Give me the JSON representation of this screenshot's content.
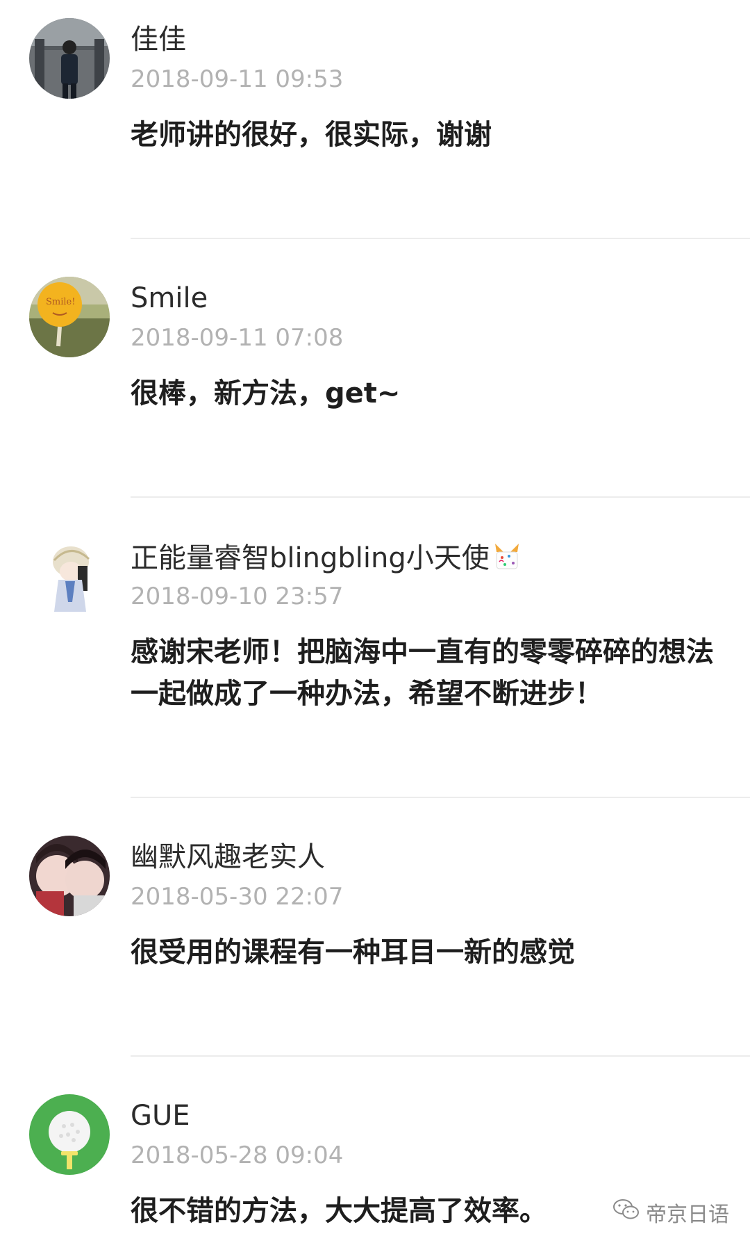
{
  "comments": [
    {
      "name": "佳佳",
      "time": "2018-09-11 09:53",
      "text": "老师讲的很好，很实际，谢谢",
      "avatar_icon": "photo-person-icon"
    },
    {
      "name": "Smile",
      "time": "2018-09-11 07:08",
      "text": "很棒，新方法，get~",
      "avatar_icon": "smile-balloon-icon"
    },
    {
      "name": "正能量睿智blingbling小天使",
      "time": "2018-09-10 23:57",
      "text": "感谢宋老师！把脑海中一直有的零零碎碎的想法一起做成了一种办法，希望不断进步！",
      "avatar_icon": "cartoon-character-icon",
      "name_emoji": "party-popper-icon"
    },
    {
      "name": "幽默风趣老实人",
      "time": "2018-05-30 22:07",
      "text": "很受用的课程有一种耳目一新的感觉",
      "avatar_icon": "anime-couple-icon"
    },
    {
      "name": "GUE",
      "time": "2018-05-28 09:04",
      "text": "很不错的方法，大大提高了效率。",
      "avatar_icon": "golf-ball-icon"
    }
  ],
  "watermark": {
    "text": "帝京日语",
    "icon": "wechat-icon"
  },
  "colors": {
    "name": "#2b2b2b",
    "time": "#b2b2b2",
    "text": "#1e1e1e",
    "divider": "#ececec",
    "golf_green": "#4caf50"
  }
}
